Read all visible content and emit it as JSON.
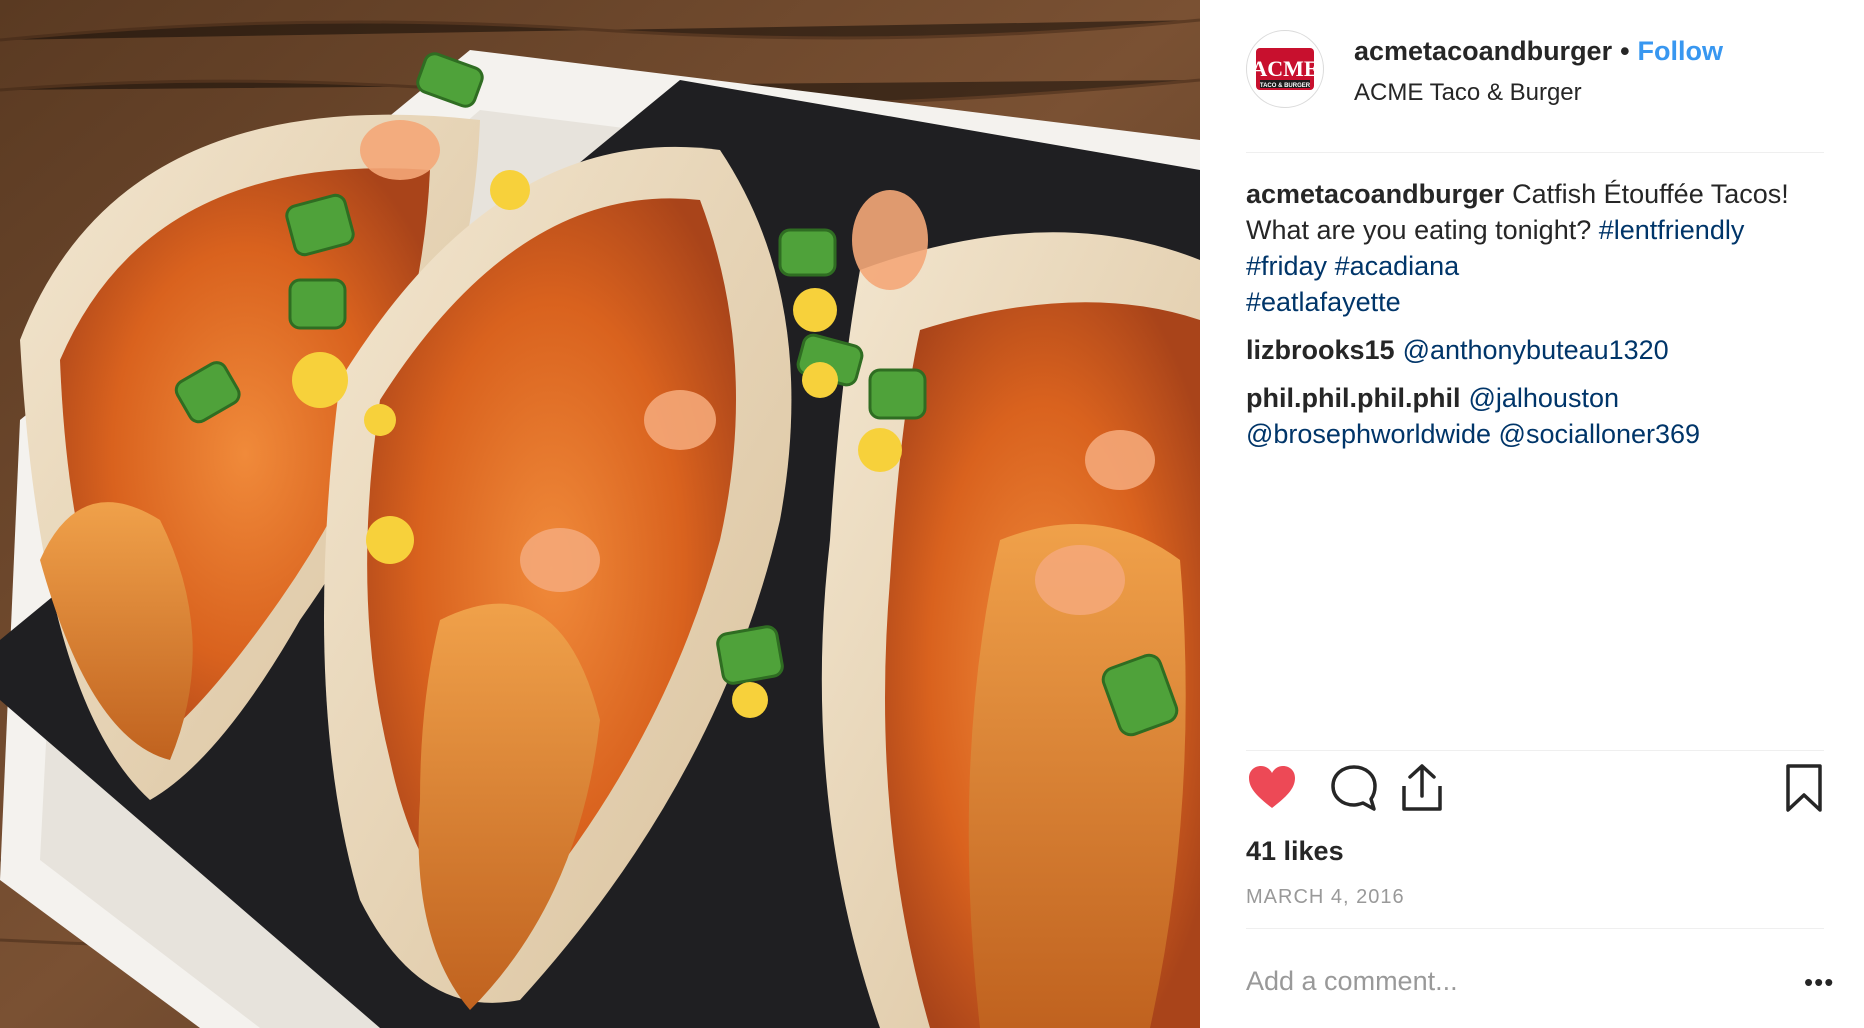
{
  "post": {
    "image_alt": "Catfish Étouffée tacos on a white plate",
    "account": {
      "username": "acmetacoandburger",
      "follow_label": "Follow",
      "dot": "•",
      "location": "ACME Taco & Burger",
      "avatar_logo_top": "ACME",
      "avatar_logo_bottom": "TACO & BURGER",
      "avatar_logo_color": "#c8102e"
    },
    "caption": {
      "username": "acmetacoandburger",
      "text": "Catfish Étouffée Tacos! What are you eating tonight?",
      "hashtags": [
        "#lentfriendly",
        "#friday",
        "#acadiana",
        "#eatlafayette"
      ]
    },
    "comments": [
      {
        "username": "lizbrooks15",
        "mentions": [
          "@anthonybuteau1320"
        ]
      },
      {
        "username": "phil.phil.phil.phil",
        "mentions": [
          "@jalhouston",
          "@brosephworldwide",
          "@socialloner369"
        ]
      }
    ],
    "actions": {
      "like_icon": "heart-filled-icon",
      "comment_icon": "comment-bubble-icon",
      "share_icon": "share-upload-icon",
      "save_icon": "bookmark-icon",
      "like_color": "#ed4956"
    },
    "likes": "41 likes",
    "date": "MARCH 4, 2016",
    "add_comment_placeholder": "Add a comment...",
    "more_label": "•••",
    "link_color": "#003569",
    "follow_color": "#3897f0"
  }
}
